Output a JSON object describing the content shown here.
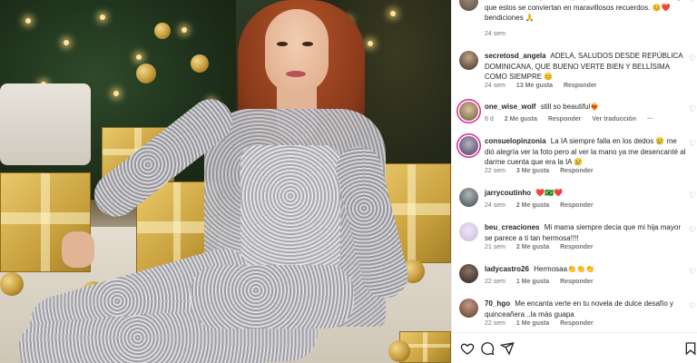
{
  "comments": [
    {
      "user": "",
      "text": "todos sus seres queridos, que pasen excelentes momentos y que estos se conviertan en maravillosos recuerdos. 😊❤️ bendiciones 🙏",
      "time": "24 sem",
      "likes": "",
      "reply": "",
      "extra": ""
    },
    {
      "user": "secretosd_angela",
      "text": "ADELA, SALUDOS DESDE REPÚBLICA DOMINICANA, QUE BUENO VERTE BIEN Y BELLÍSIMA COMO SIEMPRE 😊",
      "time": "24 sem",
      "likes": "13 Me gusta",
      "reply": "Responder",
      "extra": ""
    },
    {
      "user": "one_wise_wolf",
      "text": "still so beautiful❤️‍🔥",
      "time": "6 d",
      "likes": "2 Me gusta",
      "reply": "Responder",
      "extra": "Ver traducción"
    },
    {
      "user": "consuelopinzonia",
      "text": "La IA siempre falla en los dedos 😢 me dió alegría ver la foto pero al ver la mano ya me desencanté al darme cuenta que era la IA 😢",
      "time": "22 sem",
      "likes": "3 Me gusta",
      "reply": "Responder",
      "extra": ""
    },
    {
      "user": "jarrycoutinho",
      "text": "❤️🇧🇷❤️",
      "time": "24 sem",
      "likes": "2 Me gusta",
      "reply": "Responder",
      "extra": ""
    },
    {
      "user": "beu_creaciones",
      "text": "Mi mama siempre decia que mi hija mayor se parece a ti tan hermosa!!!!",
      "time": "21 sem",
      "likes": "2 Me gusta",
      "reply": "Responder",
      "extra": ""
    },
    {
      "user": "ladycastro26",
      "text": "Hermosaa👏👏👏",
      "time": "22 sem",
      "likes": "1 Me gusta",
      "reply": "Responder",
      "extra": ""
    },
    {
      "user": "70_hgo",
      "text": "Me encanta verte en tu novela de dulce desafío y quinceañera ..la más guapa",
      "time": "22 sem",
      "likes": "1 Me gusta",
      "reply": "Responder",
      "extra": ""
    }
  ],
  "icons": {
    "like": "heart-outline-icon",
    "comment": "comment-bubble-icon",
    "share": "paper-plane-icon",
    "save": "bookmark-icon",
    "more": "ellipsis-icon"
  },
  "colors": {
    "text": "#262626",
    "meta": "#737373",
    "story_ring": "#d6249f"
  }
}
